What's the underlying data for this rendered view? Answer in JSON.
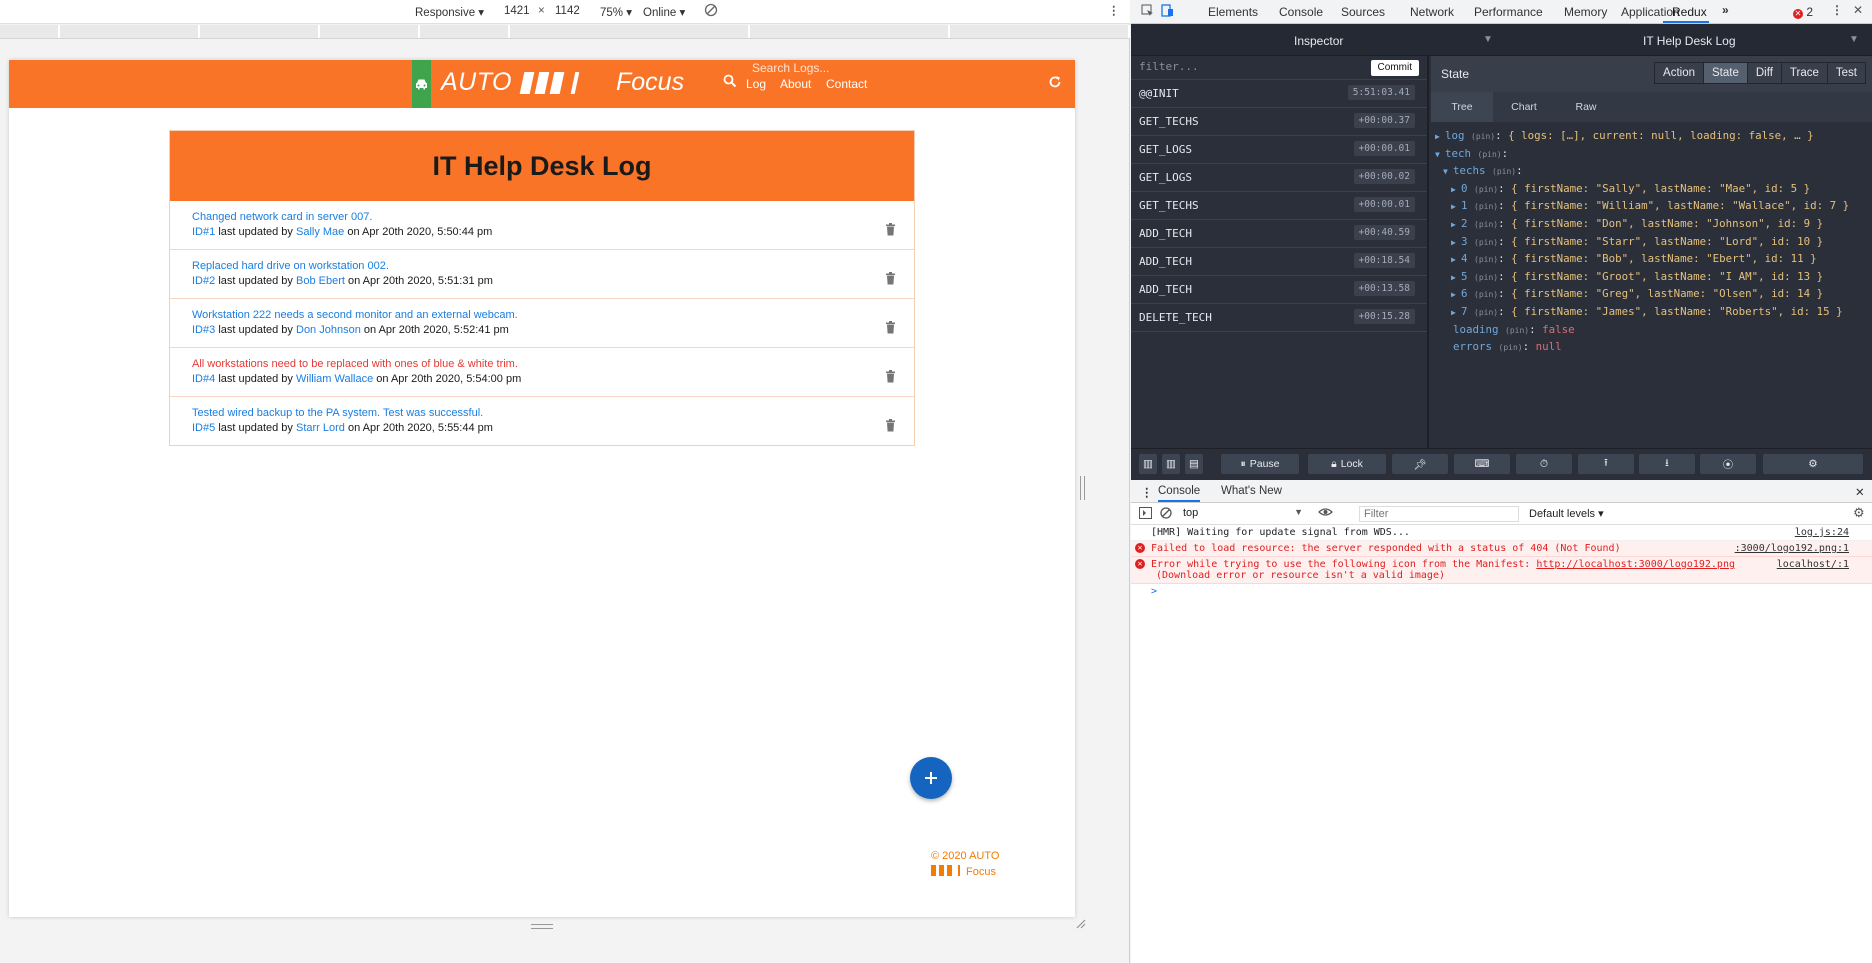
{
  "emulation": {
    "device": "Responsive",
    "width": "1421",
    "height": "1142",
    "zoom": "75%",
    "network": "Online"
  },
  "app": {
    "brand_auto": "AUTO",
    "brand_focus": "Focus",
    "search_placeholder": "Search Logs...",
    "nav": [
      "Log",
      "About",
      "Contact"
    ],
    "title": "IT Help Desk Log",
    "logs": [
      {
        "message": "Changed network card in server 007.",
        "attention": false,
        "id": "ID#1",
        "updated_text": "last updated by",
        "tech": "Sally Mae",
        "date": "on Apr 20th 2020, 5:50:44 pm"
      },
      {
        "message": "Replaced hard drive on workstation 002.",
        "attention": false,
        "id": "ID#2",
        "updated_text": "last updated by",
        "tech": "Bob Ebert",
        "date": "on Apr 20th 2020, 5:51:31 pm"
      },
      {
        "message": "Workstation 222 needs a second monitor and an external webcam.",
        "attention": false,
        "id": "ID#3",
        "updated_text": "last updated by",
        "tech": "Don Johnson",
        "date": "on Apr 20th 2020, 5:52:41 pm"
      },
      {
        "message": "All workstations need to be replaced with ones of blue & white trim.",
        "attention": true,
        "id": "ID#4",
        "updated_text": "last updated by",
        "tech": "William Wallace",
        "date": "on Apr 20th 2020, 5:54:00 pm"
      },
      {
        "message": "Tested wired backup to the PA system. Test was successful.",
        "attention": false,
        "id": "ID#5",
        "updated_text": "last updated by",
        "tech": "Starr Lord",
        "date": "on Apr 20th 2020, 5:55:44 pm"
      }
    ],
    "footer_line1": "© 2020 AUTO",
    "footer_focus": "Focus",
    "colors": {
      "brand": "#fa7428",
      "link": "#1a7ee0",
      "attention": "#e53935",
      "fab": "#1565c0",
      "car_badge": "#3fa44c"
    }
  },
  "devtools": {
    "tabs": [
      "Elements",
      "Console",
      "Sources",
      "Network",
      "Performance",
      "Memory",
      "Application",
      "Redux"
    ],
    "active_tab": "Redux",
    "error_count": "2",
    "redux": {
      "monitor": "Inspector",
      "instance": "IT Help Desk Log",
      "filter_placeholder": "filter...",
      "commit": "Commit",
      "actions": [
        {
          "name": "@@INIT",
          "time": "5:51:03.41"
        },
        {
          "name": "GET_TECHS",
          "time": "+00:00.37"
        },
        {
          "name": "GET_LOGS",
          "time": "+00:00.01"
        },
        {
          "name": "GET_LOGS",
          "time": "+00:00.02"
        },
        {
          "name": "GET_TECHS",
          "time": "+00:00.01"
        },
        {
          "name": "ADD_TECH",
          "time": "+00:40.59"
        },
        {
          "name": "ADD_TECH",
          "time": "+00:18.54"
        },
        {
          "name": "ADD_TECH",
          "time": "+00:13.58"
        },
        {
          "name": "DELETE_TECH",
          "time": "+00:15.28"
        }
      ],
      "state_label": "State",
      "modes": [
        "Action",
        "State",
        "Diff",
        "Trace",
        "Test"
      ],
      "active_mode": "State",
      "views": [
        "Tree",
        "Chart",
        "Raw"
      ],
      "active_view": "Tree",
      "pin": "(pin)",
      "tree": {
        "log_key": "log",
        "log_value": "{ logs: […], current: null, loading: false, … }",
        "tech_key": "tech",
        "techs_key": "techs",
        "techs": [
          {
            "i": "0",
            "v": "{ firstName: \"Sally\", lastName: \"Mae\", id: 5 }"
          },
          {
            "i": "1",
            "v": "{ firstName: \"William\", lastName: \"Wallace\", id: 7 }"
          },
          {
            "i": "2",
            "v": "{ firstName: \"Don\", lastName: \"Johnson\", id: 9 }"
          },
          {
            "i": "3",
            "v": "{ firstName: \"Starr\", lastName: \"Lord\", id: 10 }"
          },
          {
            "i": "4",
            "v": "{ firstName: \"Bob\", lastName: \"Ebert\", id: 11 }"
          },
          {
            "i": "5",
            "v": "{ firstName: \"Groot\", lastName: \"I AM\", id: 13 }"
          },
          {
            "i": "6",
            "v": "{ firstName: \"Greg\", lastName: \"Olsen\", id: 14 }"
          },
          {
            "i": "7",
            "v": "{ firstName: \"James\", lastName: \"Roberts\", id: 15 }"
          }
        ],
        "loading_key": "loading",
        "loading_value": "false",
        "errors_key": "errors",
        "errors_value": "null"
      },
      "pause": "Pause",
      "lock": "Lock"
    },
    "console": {
      "tabs": [
        "Console",
        "What's New"
      ],
      "context": "top",
      "filter_placeholder": "Filter",
      "levels": "Default levels",
      "messages": [
        {
          "type": "info",
          "text": "[HMR] Waiting for update signal from WDS...",
          "source": "log.js:24"
        },
        {
          "type": "error",
          "text": "Failed to load resource: the server responded with a status of 404 (Not Found)",
          "source": ":3000/logo192.png:1"
        },
        {
          "type": "error",
          "text": "Error while trying to use the following icon from the Manifest: ",
          "link": "http://localhost:3000/logo192.png",
          "text2": "(Download error or resource isn't a valid image)",
          "source": "localhost/:1"
        }
      ],
      "prompt": ">"
    }
  }
}
